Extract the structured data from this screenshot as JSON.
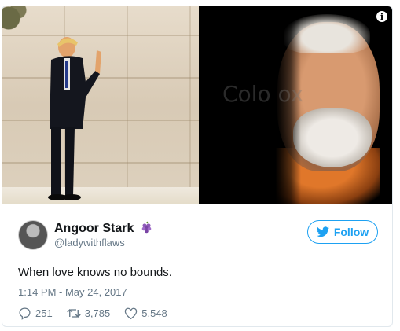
{
  "tweet": {
    "author_name": "Angoor Stark",
    "author_handle": "@ladywithflaws",
    "follow_label": "Follow",
    "text": "When love knows no bounds.",
    "timestamp": "1:14 PM - May 24, 2017",
    "replies": "251",
    "retweets": "3,785",
    "likes": "5,548"
  },
  "media": {
    "info_icon": "i",
    "watermark": "Colo  ox"
  },
  "icons": {
    "grape": "grape-emoji-icon",
    "twitter": "twitter-bird-icon",
    "reply": "reply-icon",
    "retweet": "retweet-icon",
    "like": "heart-icon"
  },
  "colors": {
    "accent": "#1da1f2",
    "text": "#14171a",
    "muted": "#657786",
    "border": "#e1e8ed"
  }
}
